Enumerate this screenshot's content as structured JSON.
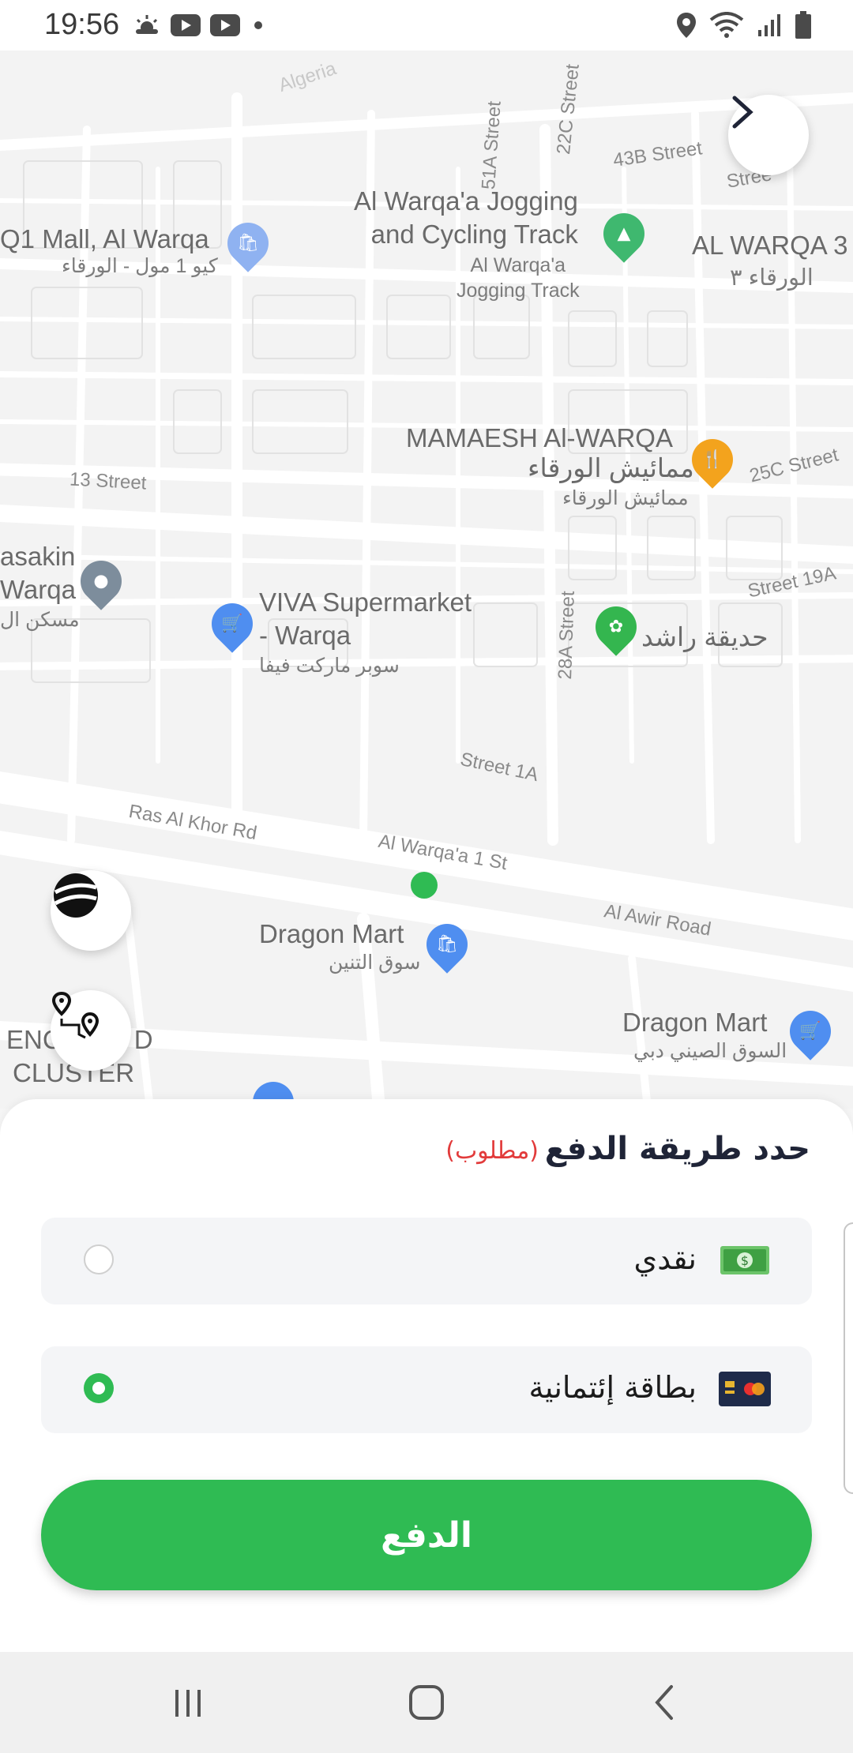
{
  "status_bar": {
    "time": "19:56",
    "left_icons": [
      "weather-icon",
      "youtube-icon",
      "youtube-icon",
      "dot-icon"
    ],
    "right_icons": [
      "location-icon",
      "wifi-icon",
      "signal-icon",
      "battery-icon"
    ]
  },
  "map": {
    "labels": {
      "algeria": "Algeria",
      "st_51a": "51A Street",
      "st_22c": "22C Street",
      "st_43b": "43B Street",
      "st_partial": "Stree",
      "jogging_en_1": "Al Warqa'a Jogging",
      "jogging_en_2": "and Cycling Track",
      "jogging_sub_1": "Al Warqa'a",
      "jogging_sub_2": "Jogging Track",
      "q1_mall": "Q1 Mall, Al Warqa",
      "q1_mall_ar": "كيو 1 مول - الورقاء",
      "warqa3": "AL WARQA 3",
      "warqa3_ar": "الورقاء ٣",
      "mamaesh": "MAMAESH Al-WARQA",
      "mamaesh_ar": "ممائيش الورقاء",
      "mamaesh_ar2": "ممائيش الورقاء",
      "st_25c": "25C Street",
      "st_13": "13 Street",
      "masakin_1": "asakin",
      "masakin_2": "Warqa",
      "masakin_ar": "مسكن ال",
      "st_19a": "Street 19A",
      "viva_1": "VIVA Supermarket",
      "viva_2": "- Warqa",
      "viva_ar": "سوبر ماركت فيفا",
      "st_28a": "28A Street",
      "rashid_park": "حديقة راشد",
      "st_1a": "Street 1A",
      "ras_al_khor": "Ras Al Khor Rd",
      "warqa_1_st": "Al Warqa'a 1 St",
      "al_awir": "Al Awir Road",
      "dragon_mart_1": "Dragon Mart",
      "dragon_mart_1_ar": "سوق التنين",
      "dragon_mart_2": "Dragon Mart",
      "dragon_mart_2_ar": "السوق الصيني دبي",
      "cluster_1": "ENC",
      "cluster_1b": "D",
      "cluster_2": "CLUSTER"
    }
  },
  "payment_sheet": {
    "title": "حدد طريقة الدفع",
    "required_label": "(مطلوب)",
    "options": [
      {
        "label": "نقدي",
        "icon": "cash-icon",
        "selected": false
      },
      {
        "label": "بطاقة إئتمانية",
        "icon": "credit-card-icon",
        "selected": true
      }
    ],
    "pay_button_label": "الدفع",
    "accent_color": "#2fbb53"
  },
  "nav_bar": {
    "buttons": [
      "recents-button",
      "home-button",
      "back-button"
    ]
  }
}
